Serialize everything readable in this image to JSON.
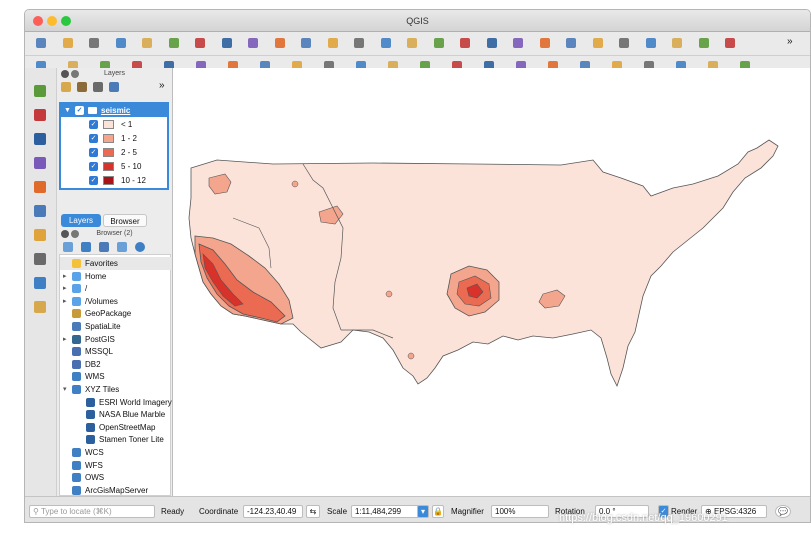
{
  "window": {
    "title": "QGIS"
  },
  "toolbar_overflow": "»",
  "colors": {
    "selection": "#3b8ad9",
    "class_1": "#fbe3da",
    "class_2": "#f3a58e",
    "class_3": "#ea6a52",
    "class_4": "#d8322a",
    "class_5": "#a81418",
    "land": "#fbe3da"
  },
  "layers_panel": {
    "title": "Layers",
    "overflow": "»",
    "layer": {
      "name": "seismic"
    },
    "classes": [
      {
        "label": "< 1",
        "color": "#fbe3da"
      },
      {
        "label": "1 - 2",
        "color": "#f3a58e"
      },
      {
        "label": "2 - 5",
        "color": "#ea6a52"
      },
      {
        "label": "5 - 10",
        "color": "#d8322a"
      },
      {
        "label": "10 - 12",
        "color": "#a81418"
      }
    ],
    "tabs": {
      "layers": "Layers",
      "browser": "Browser"
    }
  },
  "browser_panel": {
    "title": "Browser (2)",
    "items": [
      {
        "label": "Favorites",
        "icon": "star-icon"
      },
      {
        "label": "Home",
        "icon": "folder-icon"
      },
      {
        "label": "/",
        "icon": "folder-icon"
      },
      {
        "label": "/Volumes",
        "icon": "folder-icon"
      },
      {
        "label": "GeoPackage",
        "icon": "geopackage-icon"
      },
      {
        "label": "SpatiaLite",
        "icon": "spatialite-icon"
      },
      {
        "label": "PostGIS",
        "icon": "elephant-icon"
      },
      {
        "label": "MSSQL",
        "icon": "mssql-icon"
      },
      {
        "label": "DB2",
        "icon": "db2-icon"
      },
      {
        "label": "WMS",
        "icon": "globe-icon"
      },
      {
        "label": "XYZ Tiles",
        "icon": "globe-icon"
      },
      {
        "label": "ESRI World Imagery",
        "icon": "tile-icon"
      },
      {
        "label": "NASA Blue Marble",
        "icon": "tile-icon"
      },
      {
        "label": "OpenStreetMap",
        "icon": "tile-icon"
      },
      {
        "label": "Stamen Toner Lite",
        "icon": "tile-icon"
      },
      {
        "label": "WCS",
        "icon": "globe-icon"
      },
      {
        "label": "WFS",
        "icon": "globe-icon"
      },
      {
        "label": "OWS",
        "icon": "globe-icon"
      },
      {
        "label": "ArcGisMapServer",
        "icon": "globe-icon"
      }
    ]
  },
  "statusbar": {
    "locate_placeholder": "Type to locate (⌘K)",
    "ready": "Ready",
    "coordinate_label": "Coordinate",
    "coordinate": "-124.23,40.49",
    "scale_label": "Scale",
    "scale": "1:11,484,299",
    "magnifier_label": "Magnifier",
    "magnifier": "100%",
    "rotation_label": "Rotation",
    "rotation": "0.0 °",
    "render_label": "Render",
    "crs": "EPSG:4326"
  },
  "watermark": "https://blog.csdn.net/qq_19600291"
}
